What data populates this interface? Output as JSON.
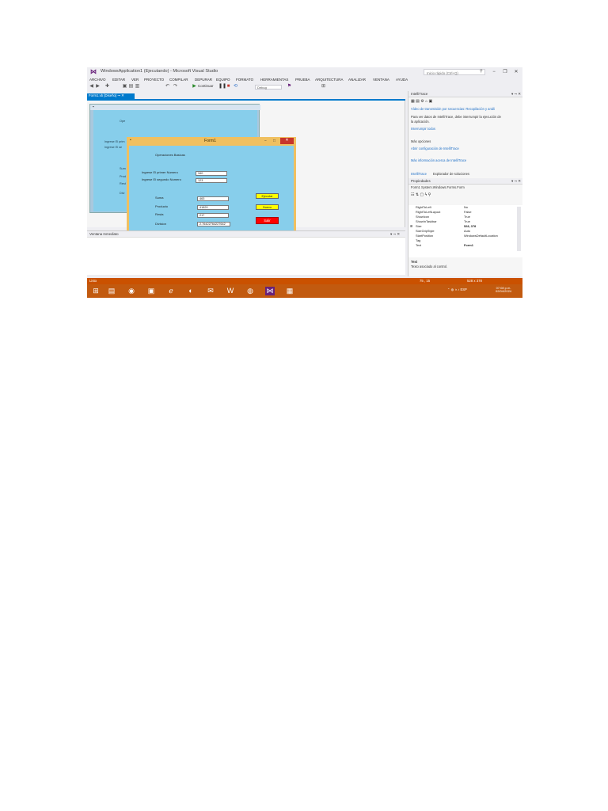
{
  "window": {
    "title": "WindowsApplication1 (Ejecutando) - Microsoft Visual Studio",
    "quick_launch_placeholder": "Inicio rápido (Ctrl+Q)"
  },
  "menu": [
    "ARCHIVO",
    "EDITAR",
    "VER",
    "PROYECTO",
    "COMPILAR",
    "DEPURAR",
    "EQUIPO",
    "FORMATO",
    "HERRAMIENTAS",
    "PRUEBA",
    "ARQUITECTURA",
    "ANALIZAR",
    "VENTANA",
    "AYUDA"
  ],
  "toolbar": {
    "continue_label": "Continuar",
    "config_value": "Debug"
  },
  "doc_tab": {
    "label": "Form1.vb [Diseño]"
  },
  "designer_labels": [
    "Ope",
    "Ingrese El prim",
    "Ingrese El se",
    "Sum",
    "Prod",
    "Rest",
    "Divi"
  ],
  "form1": {
    "title": "Form1",
    "heading": "Operaciones Basicas",
    "label_first": "Ingrese El primer Numero",
    "label_second": "Ingrese El segundo Numero",
    "value_first": "340",
    "value_second": "123",
    "label_sum": "Suma",
    "label_product": "Producto",
    "label_sub": "Resta",
    "label_div": "Division",
    "value_sum": "463",
    "value_product": "41820",
    "value_sub": "217",
    "value_div": "2.76422764227642",
    "btn_run": "Ejecutar",
    "btn_new": "Nuevo",
    "btn_exit": "Salir",
    "colors": {
      "body": "#87ceeb",
      "frame": "#f0c060",
      "yellow_button": "#ffff00",
      "red_button": "#ff0000"
    }
  },
  "immediate": {
    "title": "Ventana Inmediato"
  },
  "intellitrace": {
    "title": "IntelliTrace",
    "video_link": "Vídeo de transmisión por secuencias: Recopilación y análi",
    "info": "Para ver datos de IntelliTrace, debe interrumpir la ejecución de",
    "info2": "la aplicación.",
    "break_all": "Interrumpir todos",
    "options_header": "Más opciones",
    "options_link": "Abrir configuración de IntelliTrace",
    "more_info": "Más información acerca de IntelliTrace",
    "tab_intellitrace": "IntelliTrace",
    "tab_solution": "Explorador de soluciones"
  },
  "properties": {
    "title": "Propiedades",
    "object": "Form1 System.Windows.Forms.Form",
    "rows": [
      {
        "k": "RightToLeft",
        "v": "No"
      },
      {
        "k": "RightToLeftLayout",
        "v": "False"
      },
      {
        "k": "ShowIcon",
        "v": "True"
      },
      {
        "k": "ShowInTaskbar",
        "v": "True"
      },
      {
        "k": "Size",
        "v": "528, 378"
      },
      {
        "k": "SizeGripStyle",
        "v": "Auto"
      },
      {
        "k": "StartPosition",
        "v": "WindowsDefaultLocation"
      },
      {
        "k": "Tag",
        "v": ""
      },
      {
        "k": "Text",
        "v": "Form1"
      }
    ],
    "desc_title": "Text",
    "desc_body": "Texto asociado al control."
  },
  "status": {
    "text": "Listo",
    "position": "75 , 15",
    "size": "528 x 378"
  },
  "taskbar": {
    "lang": "ESP",
    "time": "07:08 p.m.",
    "date": "02/04/2024"
  },
  "accent": "#007acc",
  "status_color": "#ca5100"
}
